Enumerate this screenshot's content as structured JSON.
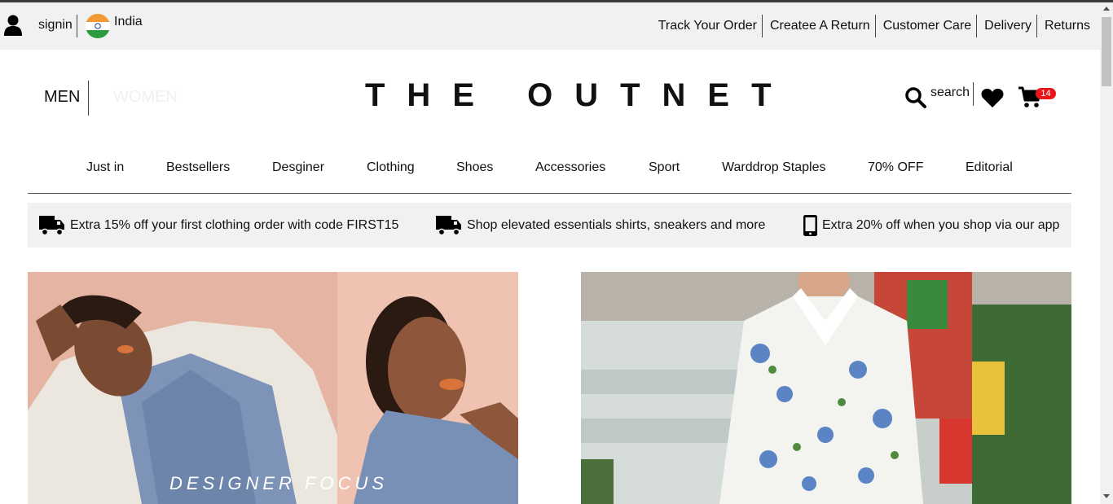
{
  "topbar": {
    "signin_label": "signin",
    "country": "India",
    "links": [
      "Track Your Order",
      "Createe A Return",
      "Customer Care",
      "Delivery",
      "Returns"
    ]
  },
  "header": {
    "men_label": "MEN",
    "women_label": "WOMEN",
    "logo": "THE OUTNET",
    "search_label": "search",
    "cart_count": "14"
  },
  "categories": [
    "Just in",
    "Bestsellers",
    "Desginer",
    "Clothing",
    "Shoes",
    "Accessories",
    "Sport",
    "Warddrop Staples",
    "70% OFF",
    "Editorial"
  ],
  "promos": [
    {
      "icon": "truck-icon",
      "text": "Extra 15% off your first clothing order with code FIRST15"
    },
    {
      "icon": "truck-icon",
      "text": "Shop elevated essentials shirts, sneakers and more"
    },
    {
      "icon": "phone-icon",
      "text": "Extra 20% off when you shop via our app"
    }
  ],
  "hero": {
    "left_caption": "DESIGNER FOCUS"
  },
  "colors": {
    "utility_bg": "#f1f1f1",
    "badge": "#e8151b",
    "text": "#111111"
  }
}
